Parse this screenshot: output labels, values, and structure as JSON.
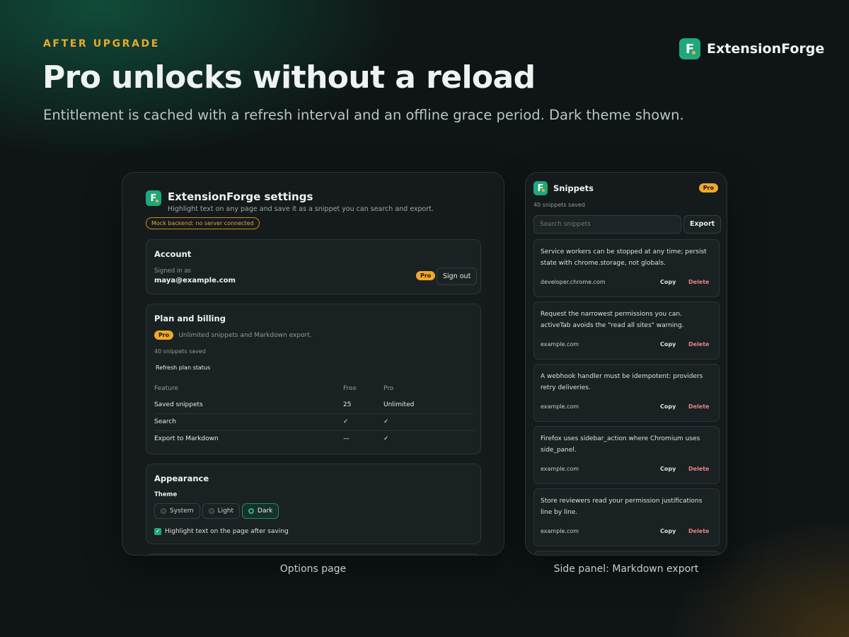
{
  "hero": {
    "eyebrow": "AFTER UPGRADE",
    "headline": "Pro unlocks without a reload",
    "subline": "Entitlement is cached with a refresh interval and an offline grace period. Dark theme shown."
  },
  "brand": {
    "logo_letter": "F.",
    "name": "ExtensionForge"
  },
  "options": {
    "caption": "Options page",
    "title": "ExtensionForge settings",
    "description": "Highlight text on any page and save it as a snippet you can search and export.",
    "mock_badge": "Mock backend: no server connected",
    "account": {
      "title": "Account",
      "signed_in_label": "Signed in as",
      "email": "maya@example.com",
      "plan_badge": "Pro",
      "sign_out": "Sign out"
    },
    "billing": {
      "title": "Plan and billing",
      "plan_badge": "Pro",
      "plan_desc": "Unlimited snippets and Markdown export.",
      "saved_count": "40 snippets saved",
      "refresh": "Refresh plan status",
      "headers": [
        "Feature",
        "Free",
        "Pro"
      ],
      "rows": [
        [
          "Saved snippets",
          "25",
          "Unlimited"
        ],
        [
          "Search",
          "✓",
          "✓"
        ],
        [
          "Export to Markdown",
          "—",
          "✓"
        ]
      ]
    },
    "appearance": {
      "title": "Appearance",
      "theme_label": "Theme",
      "themes": [
        "System",
        "Light",
        "Dark"
      ],
      "selected_theme": "Dark",
      "highlight_checkbox": "Highlight text on the page after saving",
      "highlight_checked": true
    }
  },
  "panel": {
    "caption": "Side panel: Markdown export",
    "title": "Snippets",
    "plan_badge": "Pro",
    "count": "40 snippets saved",
    "search_placeholder": "Search snippets",
    "export": "Export",
    "copy_label": "Copy",
    "delete_label": "Delete",
    "snippets": [
      {
        "text": "Service workers can be stopped at any time; persist state with chrome.storage, not globals.",
        "source": "developer.chrome.com"
      },
      {
        "text": "Request the narrowest permissions you can. activeTab avoids the \"read all sites\" warning.",
        "source": "example.com"
      },
      {
        "text": "A webhook handler must be idempotent: providers retry deliveries.",
        "source": "example.com"
      },
      {
        "text": "Firefox uses sidebar_action where Chromium uses side_panel.",
        "source": "example.com"
      },
      {
        "text": "Store reviewers read your permission justifications line by line.",
        "source": "example.com"
      }
    ]
  },
  "colors": {
    "accent": "#1fa879",
    "pro": "#f0a92a",
    "danger": "#e28585",
    "background": "#0f1517"
  }
}
